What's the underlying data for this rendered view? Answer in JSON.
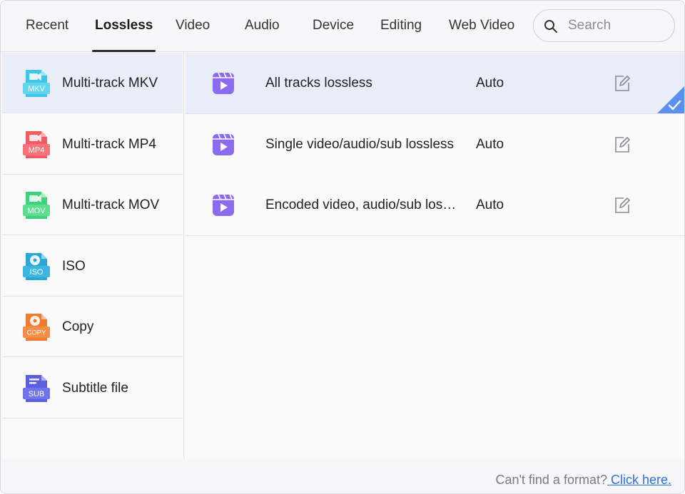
{
  "tabs": [
    {
      "label": "Recent"
    },
    {
      "label": "Lossless",
      "active": true
    },
    {
      "label": "Video"
    },
    {
      "label": "Audio"
    },
    {
      "label": "Device"
    },
    {
      "label": "Editing"
    },
    {
      "label": "Web Video"
    }
  ],
  "search": {
    "placeholder": "Search",
    "icon": "search-icon"
  },
  "sidebar": {
    "items": [
      {
        "label": "Multi-track MKV",
        "badge": "MKV",
        "icon": "mkv-file-icon",
        "color": "#3fc6e6",
        "selected": true
      },
      {
        "label": "Multi-track MP4",
        "badge": "MP4",
        "icon": "mp4-file-icon",
        "color": "#f25b64"
      },
      {
        "label": "Multi-track MOV",
        "badge": "MOV",
        "icon": "mov-file-icon",
        "color": "#3ed27a"
      },
      {
        "label": "ISO",
        "badge": "ISO",
        "icon": "iso-disc-icon",
        "color": "#2aa7d6"
      },
      {
        "label": "Copy",
        "badge": "COPY",
        "icon": "copy-disc-icon",
        "color": "#f07a2e"
      },
      {
        "label": "Subtitle file",
        "badge": "SUB",
        "icon": "subtitle-file-icon",
        "color": "#5a5fe0"
      }
    ]
  },
  "presets": [
    {
      "name": "All tracks lossless",
      "quality": "Auto",
      "selected": true
    },
    {
      "name": "Single video/audio/sub lossless",
      "quality": "Auto"
    },
    {
      "name": "Encoded video, audio/sub lossless",
      "quality": "Auto"
    }
  ],
  "footer": {
    "prompt": "Can't find a format?",
    "link": " Click here."
  },
  "colors": {
    "accent": "#2f6ee8",
    "selected_bg": "#e9edf8",
    "play_icon": "#8b6cf0",
    "check_badge": "#5b8ff0"
  }
}
